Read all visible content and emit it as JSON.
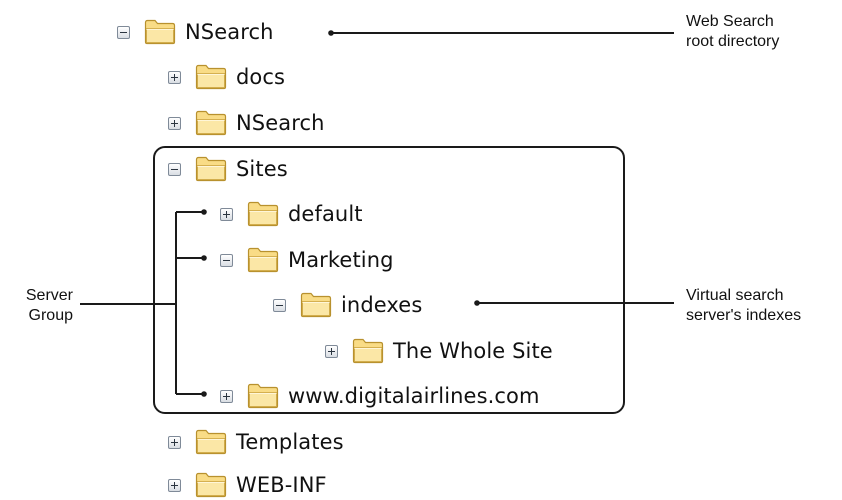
{
  "tree": {
    "root": {
      "label": "NSearch",
      "state": "expanded"
    },
    "items": [
      {
        "label": "docs",
        "state": "collapsed"
      },
      {
        "label": "NSearch",
        "state": "collapsed"
      },
      {
        "label": "Sites",
        "state": "expanded"
      },
      {
        "label": "default",
        "state": "collapsed"
      },
      {
        "label": "Marketing",
        "state": "expanded"
      },
      {
        "label": "indexes",
        "state": "expanded"
      },
      {
        "label": "The Whole Site",
        "state": "collapsed"
      },
      {
        "label": "www.digitalairlines.com",
        "state": "collapsed"
      },
      {
        "label": "Templates",
        "state": "collapsed"
      },
      {
        "label": "WEB-INF",
        "state": "collapsed"
      }
    ]
  },
  "annotations": {
    "root_dir": {
      "line1": "Web Search",
      "line2": "root directory"
    },
    "server_group": {
      "line1": "Server",
      "line2": "Group"
    },
    "virtual_indexes": {
      "line1": "Virtual search",
      "line2": "server's indexes"
    }
  },
  "colors": {
    "folder_fill": "#f7d26a",
    "folder_edge": "#b8912e",
    "toggle_border": "#7f8a98",
    "line": "#1a1a1a"
  },
  "icons": {
    "expand": "plus-box-icon",
    "collapse": "minus-box-icon",
    "folder": "folder-icon"
  }
}
